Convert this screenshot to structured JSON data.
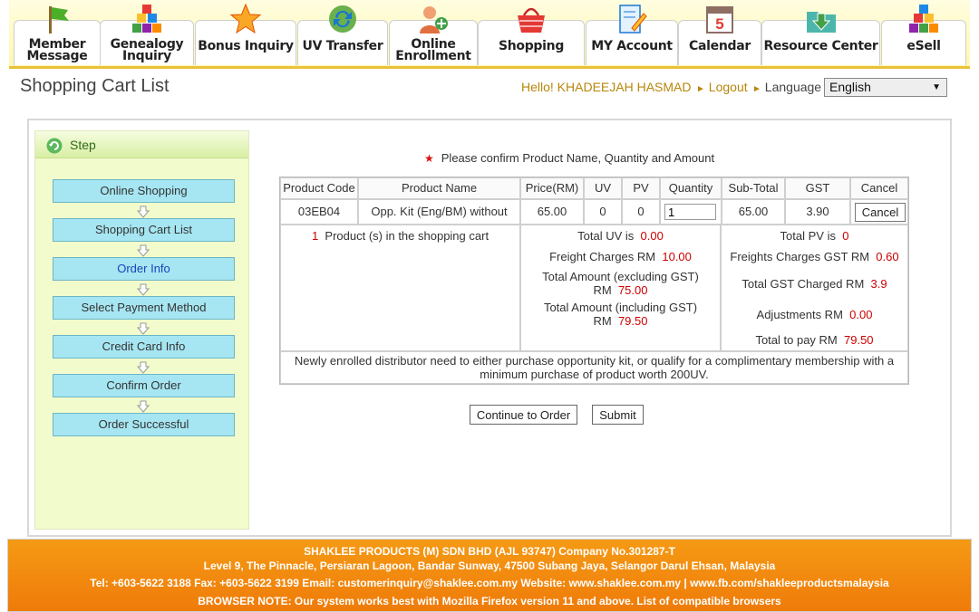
{
  "nav": [
    {
      "label_l1": "Member",
      "label_l2": "Message",
      "icon": "flag-icon"
    },
    {
      "label_l1": "Genealogy",
      "label_l2": "Inquiry",
      "icon": "blocks-icon"
    },
    {
      "label_l1": "Bonus Inquiry",
      "label_l2": "",
      "icon": "star-icon"
    },
    {
      "label_l1": "UV Transfer",
      "label_l2": "",
      "icon": "refresh-icon"
    },
    {
      "label_l1": "Online",
      "label_l2": "Enrollment",
      "icon": "add-user-icon"
    },
    {
      "label_l1": "Shopping",
      "label_l2": "",
      "icon": "basket-icon"
    },
    {
      "label_l1": "MY Account",
      "label_l2": "",
      "icon": "document-edit-icon"
    },
    {
      "label_l1": "Calendar",
      "label_l2": "",
      "icon": "calendar-icon"
    },
    {
      "label_l1": "Resource Center",
      "label_l2": "",
      "icon": "download-folder-icon"
    },
    {
      "label_l1": "eSell",
      "label_l2": "",
      "icon": "blocks-icon"
    }
  ],
  "header": {
    "page_title": "Shopping Cart List",
    "greeting": "Hello! KHADEEJAH HASMAD",
    "logout": "Logout",
    "language_label": "Language",
    "language_value": "English",
    "calendar_day": "5"
  },
  "steps": {
    "title": "Step",
    "items": [
      "Online Shopping",
      "Shopping Cart List",
      "Order Info",
      "Select Payment Method",
      "Credit Card Info",
      "Confirm Order",
      "Order Successful"
    ],
    "active_index": 2
  },
  "notice": "Please confirm Product Name, Quantity and Amount",
  "cart": {
    "headers": [
      "Product Code",
      "Product Name",
      "Price(RM)",
      "UV",
      "PV",
      "Quantity",
      "Sub-Total",
      "GST",
      "Cancel"
    ],
    "row": {
      "code": "03EB04",
      "name": "Opp. Kit (Eng/BM) without",
      "price": "65.00",
      "uv": "0",
      "pv": "0",
      "quantity": "1",
      "subtotal": "65.00",
      "gst": "3.90",
      "cancel": "Cancel"
    },
    "count": "1",
    "count_label": "Product (s) in the shopping cart",
    "total_uv_label": "Total UV is",
    "total_uv": "0.00",
    "freight_label": "Freight Charges RM",
    "freight": "10.00",
    "total_ex_label_1": "Total Amount (excluding GST)",
    "total_ex_label_2": "RM",
    "total_ex": "75.00",
    "total_inc_label_1": "Total Amount (including GST)",
    "total_inc_label_2": "RM",
    "total_inc": "79.50",
    "total_pv_label": "Total PV is",
    "total_pv": "0",
    "freight_gst_label": "Freights Charges GST RM",
    "freight_gst": "0.60",
    "total_gst_label": "Total GST Charged RM",
    "total_gst": "3.9",
    "adjust_label": "Adjustments RM",
    "adjust": "0.00",
    "to_pay_label": "Total to pay RM",
    "to_pay": "79.50",
    "note": "Newly enrolled distributor need to either purchase opportunity kit, or qualify for a complimentary membership with a minimum purchase of product worth 200UV."
  },
  "buttons": {
    "continue": "Continue to Order",
    "submit": "Submit"
  },
  "footer": {
    "line1": "SHAKLEE PRODUCTS (M) SDN BHD (AJL 93747) Company No.301287-T",
    "line2": "Level 9, The Pinnacle, Persiaran Lagoon, Bandar Sunway, 47500 Subang Jaya, Selangor Darul Ehsan, Malaysia",
    "line3": "Tel: +603-5622 3188 Fax: +603-5622 3199 Email: customerinquiry@shaklee.com.my Website: www.shaklee.com.my | www.fb.com/shakleeproductsmalaysia",
    "line4": "BROWSER NOTE: Our system works best with Mozilla Firefox version 11 and above. List of compatible browsers"
  }
}
